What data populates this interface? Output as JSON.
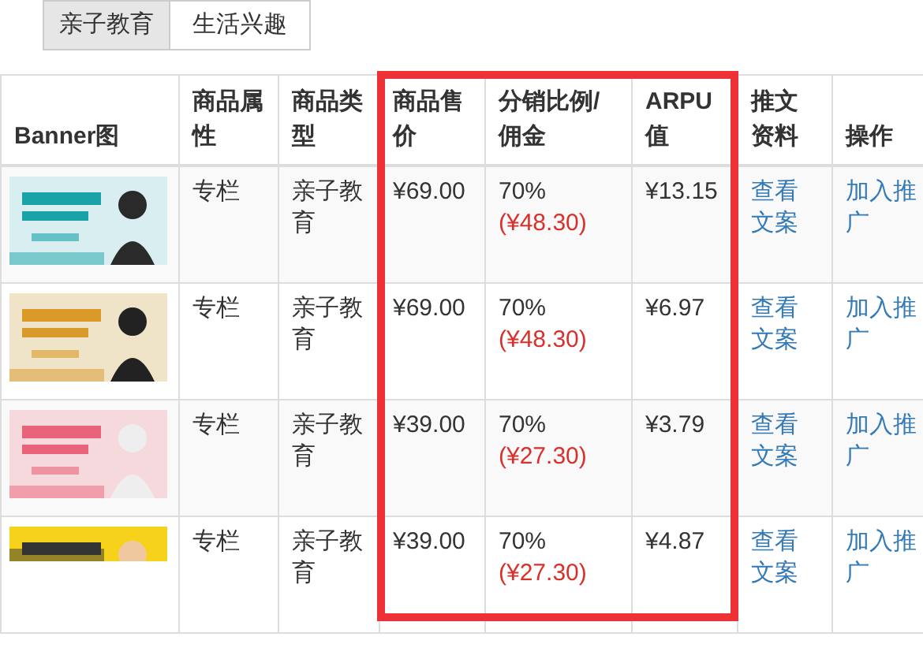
{
  "tabs": [
    {
      "label": "亲子教育",
      "selected": true
    },
    {
      "label": "生活兴趣",
      "selected": false
    }
  ],
  "table": {
    "columns": [
      {
        "label": "Banner图",
        "highlighted": false
      },
      {
        "label": "商品属性",
        "highlighted": false
      },
      {
        "label": "商品类型",
        "highlighted": false
      },
      {
        "label": "商品售价",
        "highlighted": true
      },
      {
        "label": "分销比例/佣金",
        "highlighted": true
      },
      {
        "label": "ARPU值",
        "highlighted": true
      },
      {
        "label": "推文资料",
        "highlighted": false
      },
      {
        "label": "操作",
        "highlighted": false
      }
    ],
    "rows": [
      {
        "attribute": "专栏",
        "type": "亲子教育",
        "price": "¥69.00",
        "ratio": "70%",
        "commission": "(¥48.30)",
        "arpu": "¥13.15",
        "doc_link": "查看文案",
        "action_link": "加入推广"
      },
      {
        "attribute": "专栏",
        "type": "亲子教育",
        "price": "¥69.00",
        "ratio": "70%",
        "commission": "(¥48.30)",
        "arpu": "¥6.97",
        "doc_link": "查看文案",
        "action_link": "加入推广"
      },
      {
        "attribute": "专栏",
        "type": "亲子教育",
        "price": "¥39.00",
        "ratio": "70%",
        "commission": "(¥27.30)",
        "arpu": "¥3.79",
        "doc_link": "查看文案",
        "action_link": "加入推广"
      },
      {
        "attribute": "专栏",
        "type": "亲子教育",
        "price": "¥39.00",
        "ratio": "70%",
        "commission": "(¥27.30)",
        "arpu": "¥4.87",
        "doc_link": "查看文案",
        "action_link": "加入推广"
      }
    ]
  }
}
